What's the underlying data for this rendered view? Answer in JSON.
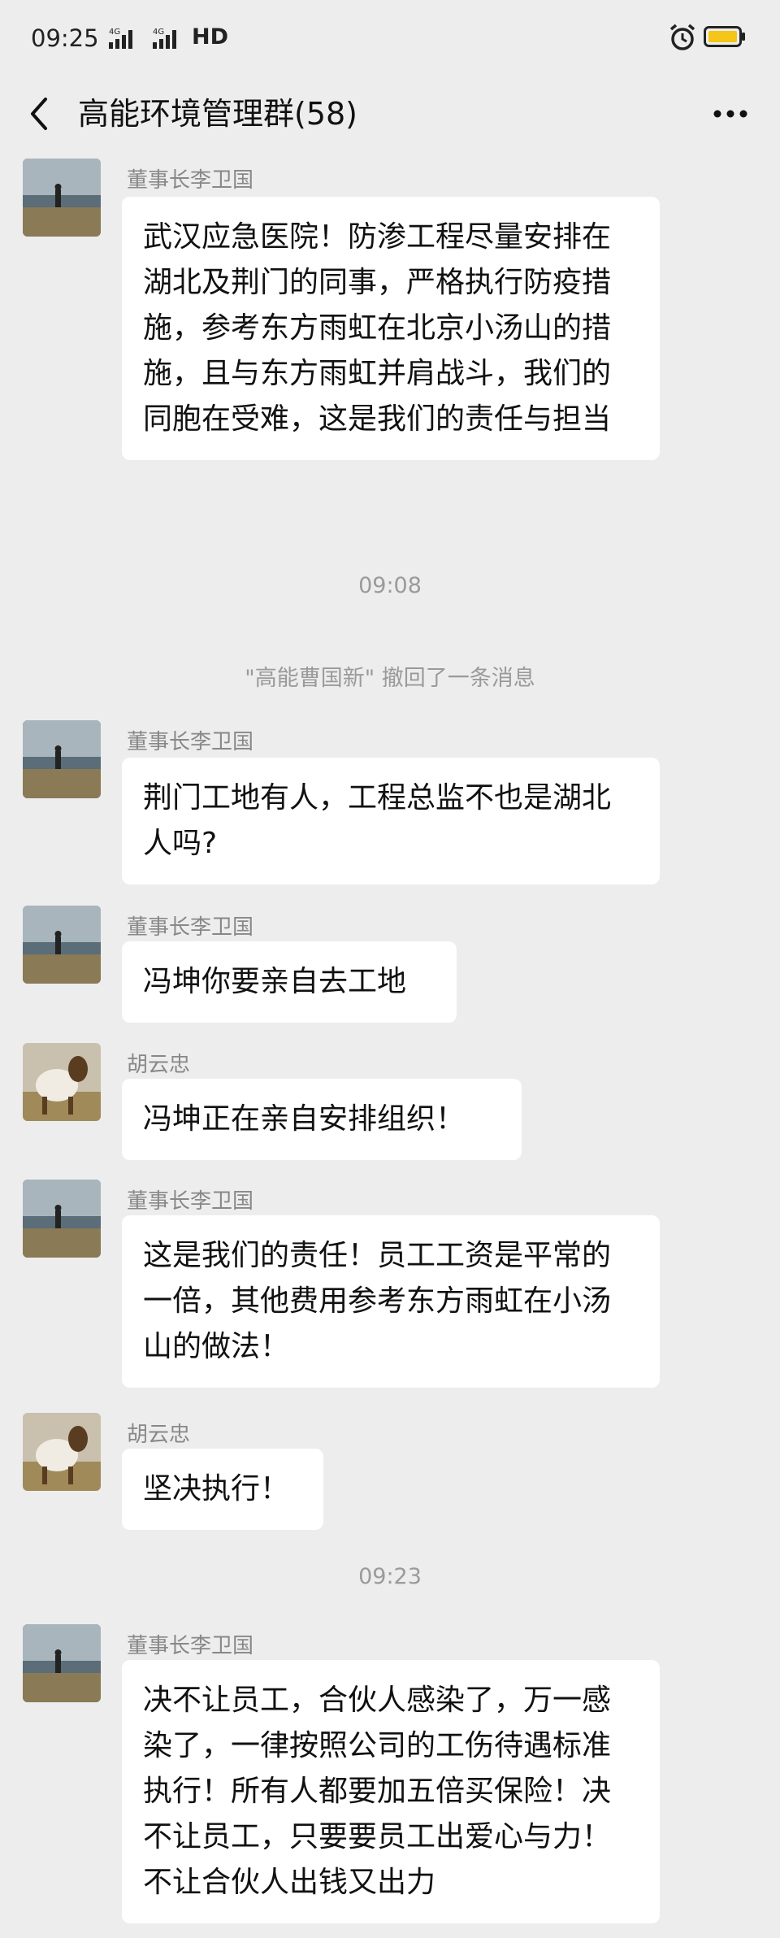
{
  "status_bar": {
    "time": "09:25",
    "network": "4G",
    "hd": "HD",
    "icons": [
      "signal-icon",
      "signal-icon",
      "alarm-icon",
      "battery-icon"
    ]
  },
  "nav": {
    "title": "高能环境管理群(58)",
    "icons": [
      "back-arrow-icon",
      "more-icon"
    ]
  },
  "messages": [
    {
      "sender": "董事长李卫国",
      "text": "武汉应急医院！防渗工程尽量安排在湖北及荆门的同事，严格执行防疫措施，参考东方雨虹在北京小汤山的措施，且与东方雨虹并肩战斗，我们的同胞在受难，这是我们的责任与担当"
    },
    {
      "system": "09:08"
    },
    {
      "system": "\"高能曹国新\" 撤回了一条消息"
    },
    {
      "sender": "董事长李卫国",
      "text": "荆门工地有人，工程总监不也是湖北人吗?"
    },
    {
      "sender": "董事长李卫国",
      "text": "冯坤你要亲自去工地"
    },
    {
      "sender": "胡云忠",
      "text": "冯坤正在亲自安排组织！"
    },
    {
      "sender": "董事长李卫国",
      "text": "这是我们的责任！员工工资是平常的一倍，其他费用参考东方雨虹在小汤山的做法！"
    },
    {
      "sender": "胡云忠",
      "text": "坚决执行！"
    },
    {
      "system": "09:23"
    },
    {
      "sender": "董事长李卫国",
      "text": "决不让员工，合伙人感染了，万一感染了，一律按照公司的工伤待遇标准执行！所有人都要加五倍买保险！决不让员工，只要要员工出爱心与力！不让合伙人出钱又出力"
    }
  ]
}
